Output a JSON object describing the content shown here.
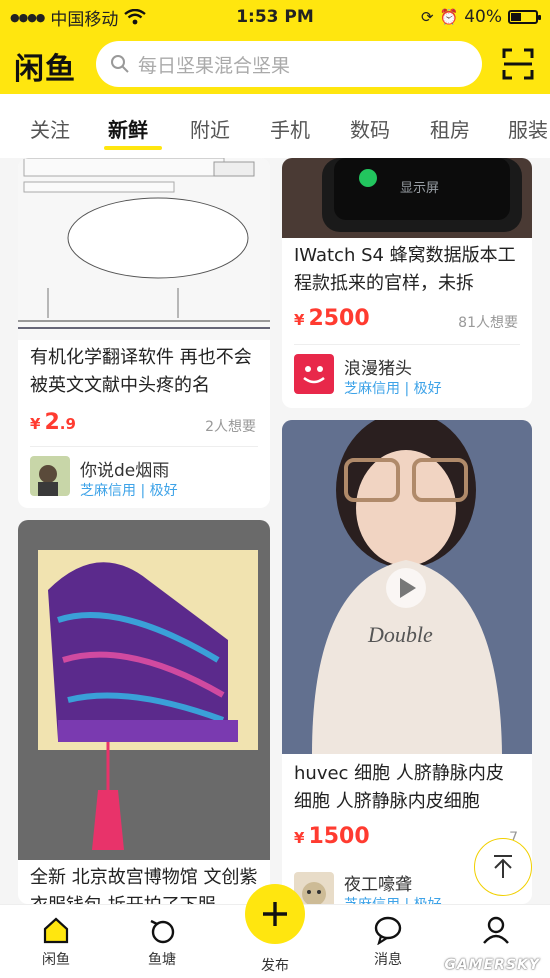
{
  "status": {
    "carrier": "中国移动",
    "time": "1:53 PM",
    "battery": "40%"
  },
  "header": {
    "logo": "闲鱼",
    "search_placeholder": "每日坚果混合坚果"
  },
  "tabs": [
    "关注",
    "新鲜",
    "附近",
    "手机",
    "数码",
    "租房",
    "服装"
  ],
  "cards": [
    {
      "title": "有机化学翻译软件 再也不会被英文文献中头疼的名",
      "price_symbol": "¥",
      "price_int": "2",
      "price_dec": ".9",
      "wants": "2人想要",
      "seller": "你说de烟雨",
      "credit": "芝麻信用 | 极好"
    },
    {
      "image_label": "显示屏",
      "title": "IWatch S4 蜂窝数据版本工程款抵来的官样，未拆",
      "price_symbol": "¥",
      "price_int": "2500",
      "wants": "81人想要",
      "seller": "浪漫猪头",
      "credit": "芝麻信用 | 极好"
    },
    {
      "title": "全新 北京故宫博物馆 文创紫 衣服钱包 拆开拍了下服",
      "price_symbol": "¥"
    },
    {
      "image_label": "Double",
      "title": "huvec 细胞 人脐静脉内皮细胞 人脐静脉内皮细胞",
      "price_symbol": "¥",
      "price_int": "1500",
      "wants": "7",
      "seller": "夜工嚎聋",
      "credit": "芝麻信用 | 极好"
    }
  ],
  "bottom_nav": [
    "闲鱼",
    "鱼塘",
    "发布",
    "消息",
    "我的"
  ],
  "watermark": "GAMERSKY",
  "colors": {
    "brand_yellow": "#ffe60f",
    "price_red": "#ff3b30",
    "credit_blue": "#3ea3e8"
  }
}
